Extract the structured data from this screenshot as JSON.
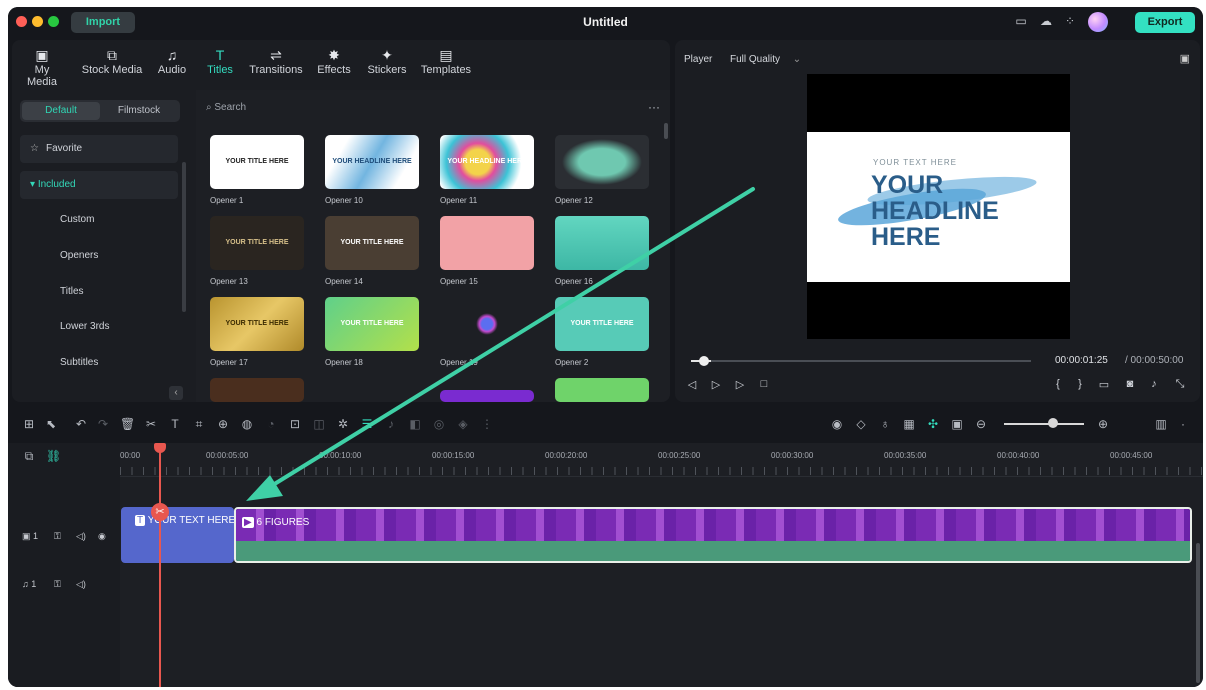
{
  "titlebar": {
    "import": "Import",
    "title": "Untitled",
    "export": "Export"
  },
  "toolbar_tabs": [
    {
      "label": "My Media",
      "icon": "my-media-icon",
      "glyph": "▣"
    },
    {
      "label": "Stock Media",
      "icon": "stock-media-icon",
      "glyph": "⧉"
    },
    {
      "label": "Audio",
      "icon": "audio-icon",
      "glyph": "♫"
    },
    {
      "label": "Titles",
      "icon": "titles-icon",
      "glyph": "T"
    },
    {
      "label": "Transitions",
      "icon": "transitions-icon",
      "glyph": "⇌"
    },
    {
      "label": "Effects",
      "icon": "effects-icon",
      "glyph": "✸"
    },
    {
      "label": "Stickers",
      "icon": "stickers-icon",
      "glyph": "✦"
    },
    {
      "label": "Templates",
      "icon": "templates-icon",
      "glyph": "▤"
    }
  ],
  "library": {
    "segment": [
      "Default",
      "Filmstock"
    ],
    "favorite": "Favorite",
    "included": "Included",
    "categories": [
      "Custom",
      "Openers",
      "Titles",
      "Lower 3rds",
      "Subtitles"
    ],
    "search_placeholder": "Search"
  },
  "thumbs": [
    {
      "label": "Opener 1",
      "text": "YOUR TITLE HERE"
    },
    {
      "label": "Opener 10",
      "text": "YOUR HEADLINE HERE"
    },
    {
      "label": "Opener 11",
      "text": "YOUR HEADLINE HERE"
    },
    {
      "label": "Opener 12",
      "text": ""
    },
    {
      "label": "Opener 13",
      "text": "YOUR TITLE HERE"
    },
    {
      "label": "Opener 14",
      "text": "YOUR TITLE HERE"
    },
    {
      "label": "Opener 15",
      "text": ""
    },
    {
      "label": "Opener 16",
      "text": ""
    },
    {
      "label": "Opener 17",
      "text": "YOUR TITLE HERE"
    },
    {
      "label": "Opener 18",
      "text": "YOUR TITLE HERE"
    },
    {
      "label": "Opener 19",
      "text": ""
    },
    {
      "label": "Opener 2",
      "text": "YOUR TITLE HERE"
    }
  ],
  "player": {
    "label": "Player",
    "quality": "Full Quality",
    "preview_small": "YOUR TEXT HERE",
    "preview_big": [
      "YOUR",
      "HEADLINE",
      "HERE"
    ],
    "current_time": "00:00:01:25",
    "total_time": "/ 00:00:50:00"
  },
  "timeline": {
    "ticks": [
      "00:00",
      "00:00:05:00",
      "00:00:10:00",
      "00:00:15:00",
      "00:00:20:00",
      "00:00:25:00",
      "00:00:30:00",
      "00:00:35:00",
      "00:00:40:00",
      "00:00:45:00"
    ],
    "video_track": "1",
    "audio_track": "1",
    "title_clip": "YOUR TEXT HERE",
    "video_clip": "6 FIGURES"
  },
  "colors": {
    "accent": "#33dcc0",
    "playhead": "#e8574f",
    "arrow": "#3fd0a6"
  }
}
